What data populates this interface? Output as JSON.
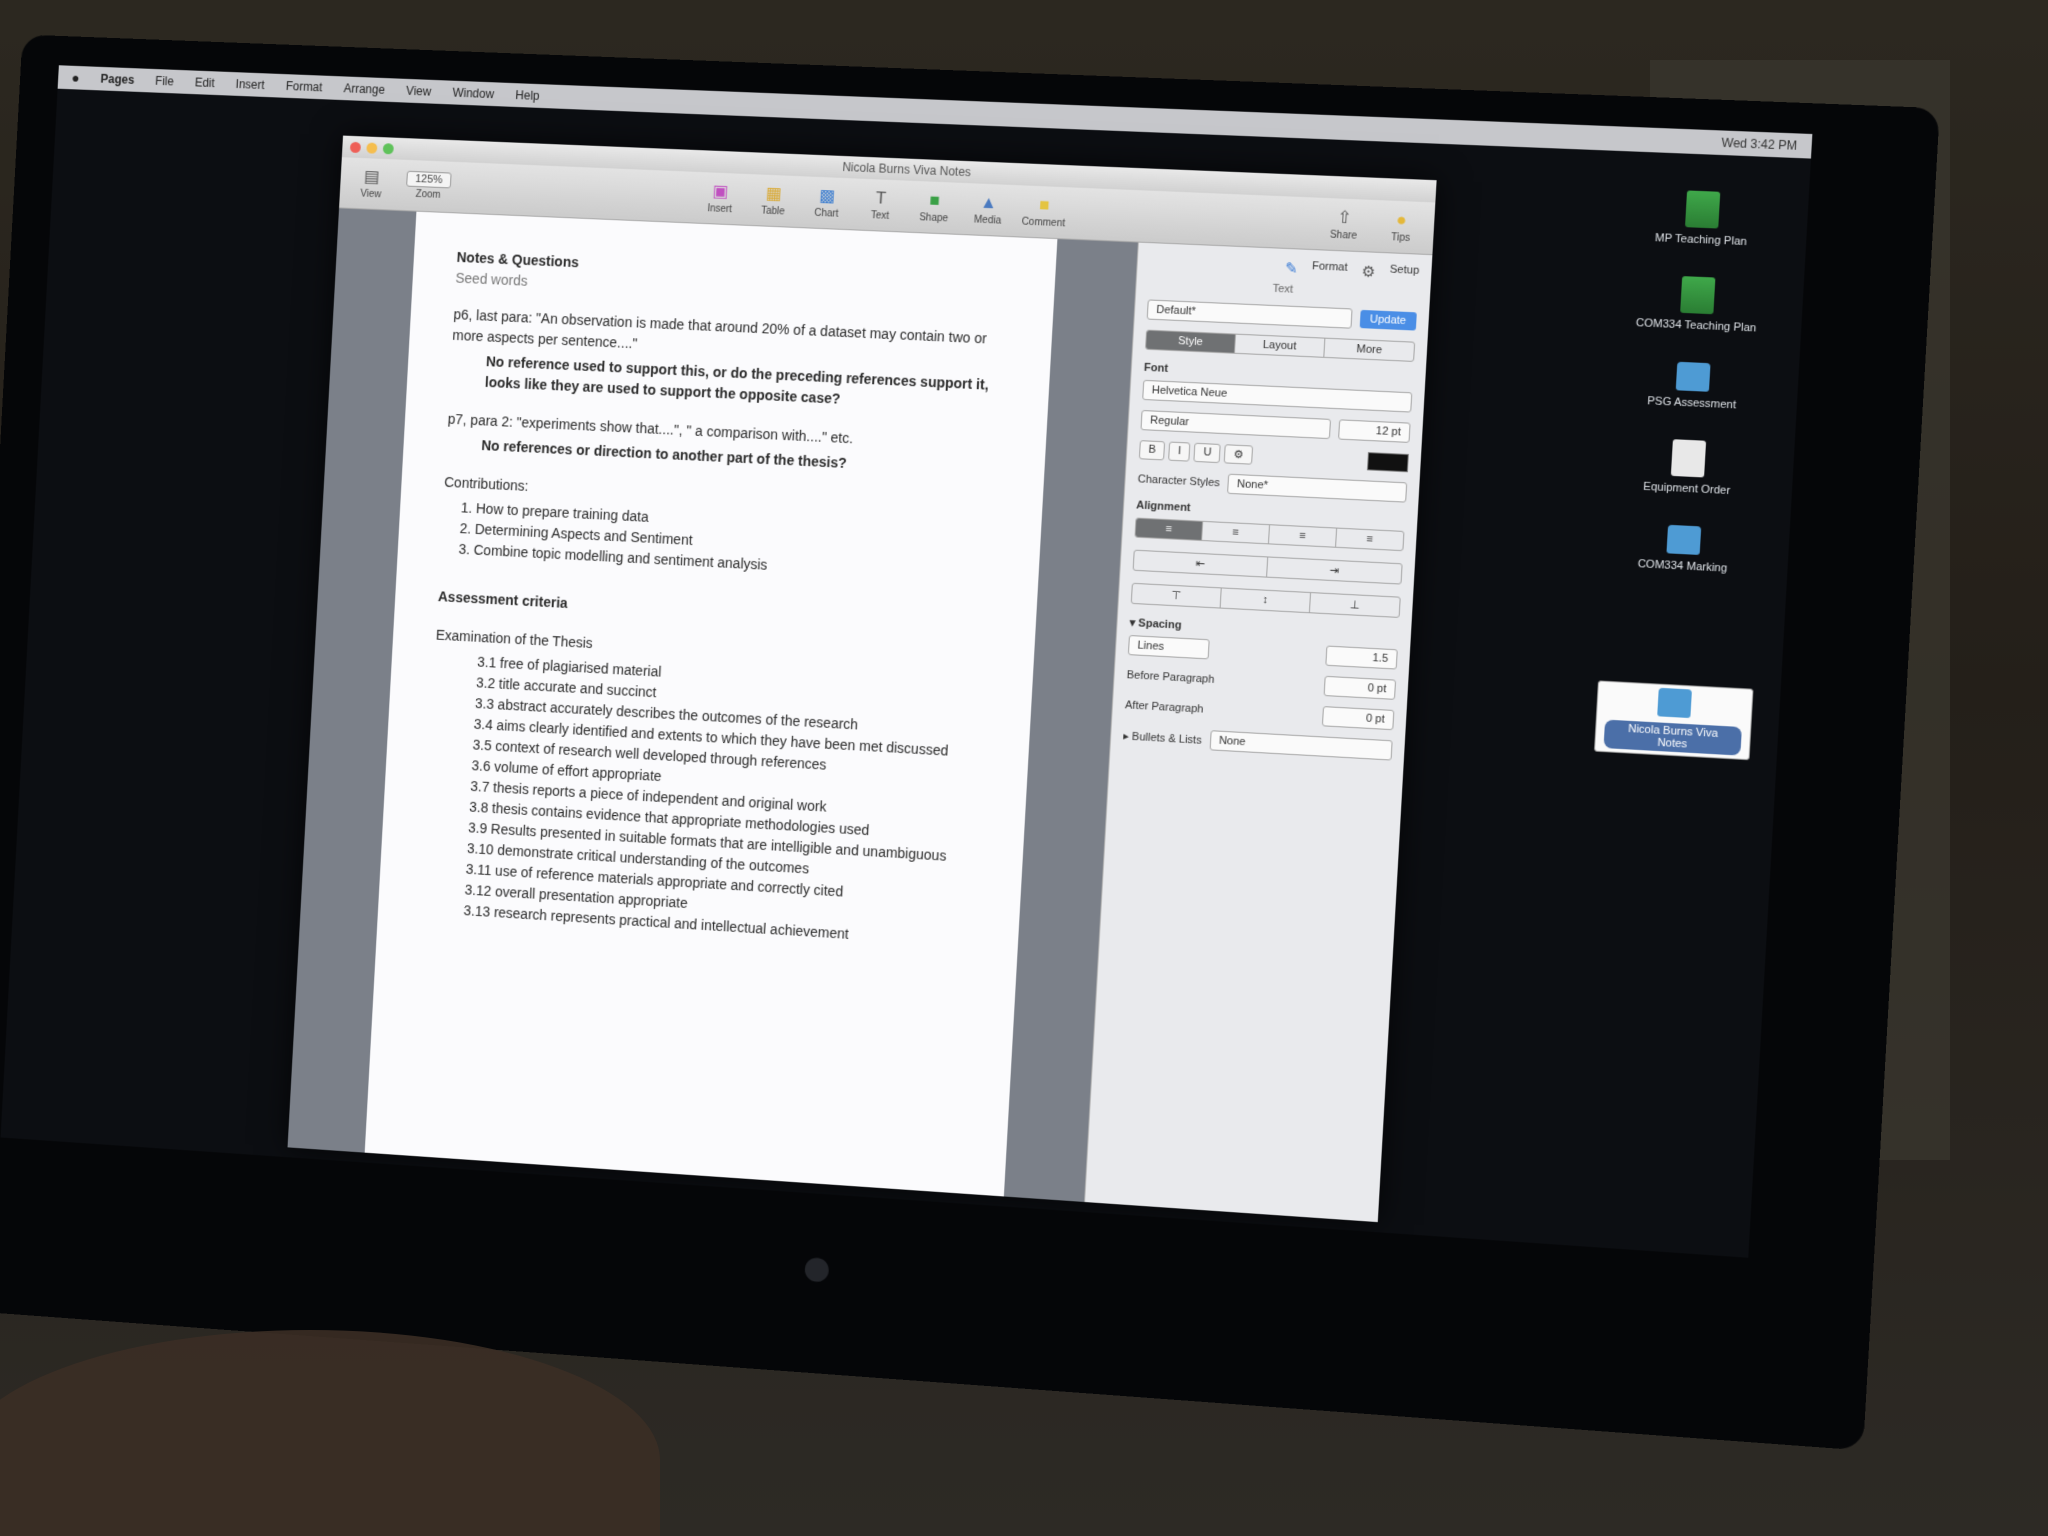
{
  "menubar": {
    "apple": "",
    "items": [
      "Pages",
      "File",
      "Edit",
      "Insert",
      "Format",
      "Arrange",
      "View",
      "Window",
      "Help"
    ],
    "clock": "Wed 3:42 PM"
  },
  "desktop": [
    {
      "label": "MP Teaching Plan",
      "type": "sheet"
    },
    {
      "label": "COM334 Teaching Plan",
      "type": "sheet"
    },
    {
      "label": "PSG Assessment",
      "type": "folder"
    },
    {
      "label": "Equipment Order",
      "type": "doc"
    },
    {
      "label": "COM334 Marking",
      "type": "folder"
    },
    {
      "label": "Nicola Burns Viva Notes",
      "type": "folder",
      "selected": true
    }
  ],
  "window": {
    "title": "Nicola Burns Viva Notes",
    "toolbar": {
      "view": "View",
      "zoom_value": "125%",
      "zoom": "Zoom",
      "tools": [
        "Insert",
        "Table",
        "Chart",
        "Text",
        "Shape",
        "Media",
        "Comment"
      ],
      "share": "Share",
      "tips": "Tips"
    },
    "inspector": {
      "tabs_top": [
        "Format",
        "Setup"
      ],
      "panel_title": "Text",
      "style": "Default*",
      "update": "Update",
      "segments": [
        "Style",
        "Layout",
        "More"
      ],
      "font_label": "Font",
      "font_name": "Helvetica Neue",
      "font_weight": "Regular",
      "font_size": "12 pt",
      "format_buttons": [
        "B",
        "I",
        "U",
        "⚙"
      ],
      "character_styles_label": "Character Styles",
      "character_styles_value": "None*",
      "alignment_label": "Alignment",
      "spacing_label": "Spacing",
      "spacing_mode": "Lines",
      "spacing_value": "1.5",
      "before_label": "Before Paragraph",
      "before_value": "0 pt",
      "after_label": "After Paragraph",
      "after_value": "0 pt",
      "bullets_label": "Bullets & Lists",
      "bullets_value": "None"
    }
  },
  "document": {
    "heading": "Notes & Questions",
    "subheading": "Seed words",
    "p6": "p6, last para: \"An observation is made that around 20% of a dataset may contain two or more aspects per sentence....\"",
    "p6_note": "No reference used to support this, or do the preceding references support it, looks like they are used to support the opposite case?",
    "p7": "p7, para 2: \"experiments show that....\", \" a comparison with....\" etc.",
    "p7_note": "No references or direction to another part of the thesis?",
    "contributions_label": "Contributions:",
    "contributions": [
      "How to prepare training data",
      "Determining Aspects and Sentiment",
      "Combine topic modelling and sentiment analysis"
    ],
    "assessment_heading": "Assessment criteria",
    "exam_heading": "Examination of the Thesis",
    "criteria": [
      "3.1  free of plagiarised material",
      "3.2 title accurate and succinct",
      "3.3  abstract accurately describes the outcomes of the research",
      "3.4  aims clearly identified and extents to which they have been met discussed",
      "3.5 context of research well developed through references",
      "3.6  volume of effort appropriate",
      "3.7 thesis reports a piece of independent and original work",
      "3.8  thesis contains evidence that appropriate methodologies used",
      "3.9  Results presented in suitable formats that are intelligible and unambiguous",
      "3.10  demonstrate critical understanding of the outcomes",
      "3.11  use of reference materials appropriate and  correctly cited",
      "3.12  overall presentation appropriate",
      "3.13  research represents practical and intellectual achievement"
    ]
  }
}
